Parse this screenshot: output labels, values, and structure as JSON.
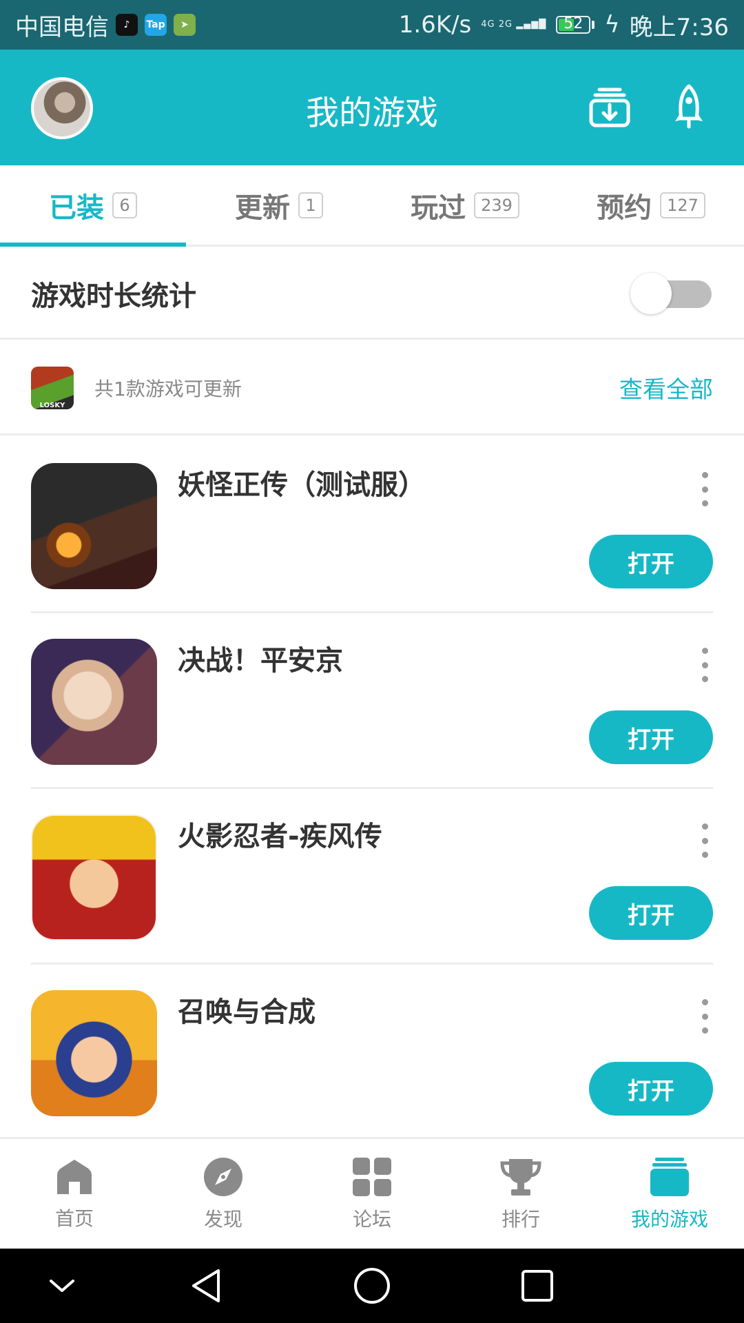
{
  "status_bar": {
    "carrier": "中国电信",
    "apps": [
      "Tap"
    ],
    "speed": "1.6K/s",
    "network": "4G 2G",
    "battery": "52",
    "time": "晚上7:36"
  },
  "header": {
    "title": "我的游戏"
  },
  "tabs": [
    {
      "label": "已装",
      "count": "6",
      "active": true
    },
    {
      "label": "更新",
      "count": "1",
      "active": false
    },
    {
      "label": "玩过",
      "count": "239",
      "active": false
    },
    {
      "label": "预约",
      "count": "127",
      "active": false
    }
  ],
  "playtime": {
    "label": "游戏时长统计",
    "enabled": false
  },
  "update_notice": {
    "icon_text": "LOSKY",
    "text": "共1款游戏可更新",
    "link": "查看全部"
  },
  "games": [
    {
      "name": "妖怪正传（测试服）",
      "button": "打开"
    },
    {
      "name": "决战！平安京",
      "button": "打开"
    },
    {
      "name": "火影忍者-疾风传",
      "button": "打开"
    },
    {
      "name": "召唤与合成",
      "button": "打开"
    }
  ],
  "bottom_nav": [
    {
      "label": "首页",
      "icon": "home-icon"
    },
    {
      "label": "发现",
      "icon": "compass-icon"
    },
    {
      "label": "论坛",
      "icon": "grid-icon"
    },
    {
      "label": "排行",
      "icon": "trophy-icon"
    },
    {
      "label": "我的游戏",
      "icon": "stack-icon",
      "active": true
    }
  ],
  "colors": {
    "accent": "#17b8c6",
    "status_bar": "#1a6671"
  }
}
